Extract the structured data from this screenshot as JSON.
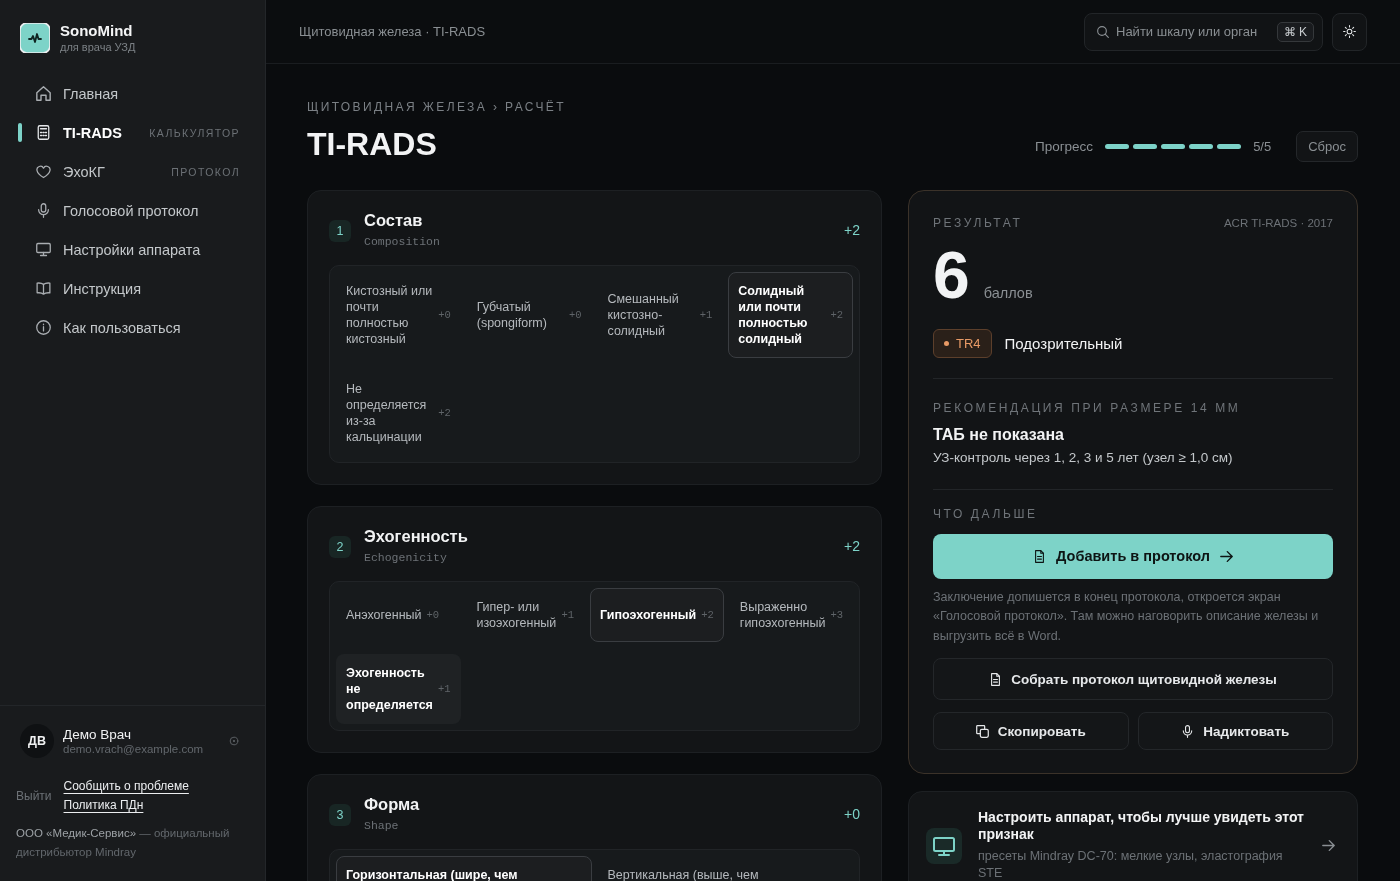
{
  "sidebar": {
    "brand": {
      "name": "SonoMind",
      "tagline": "для врача УЗД"
    },
    "nav": [
      {
        "label": "Главная",
        "selected": false
      },
      {
        "label": "TI-RADS",
        "tag": "КАЛЬКУЛЯТОР",
        "selected": true
      },
      {
        "label": "ЭхоКГ",
        "tag": "ПРОТОКОЛ",
        "selected": false
      },
      {
        "label": "Голосовой протокол",
        "selected": false
      },
      {
        "label": "Настройки аппарата",
        "selected": false
      },
      {
        "label": "Инструкция",
        "selected": false
      },
      {
        "label": "Как пользоваться",
        "selected": false
      }
    ],
    "user": {
      "initials": "ДВ",
      "name": "Демо Врач",
      "email": "demo.vrach@example.com"
    },
    "logout": "Выйти",
    "links": [
      "Сообщить о проблеме",
      "Политика ПДн"
    ],
    "footer": {
      "company": "ООО «Медик-Сервис»",
      "text": "— официальный дистрибьютор Mindray"
    }
  },
  "topbar": {
    "breadcrumb": "Щитовидная железа · TI-RADS",
    "search": {
      "placeholder": "Найти шкалу или орган",
      "shortcut": "⌘ K"
    }
  },
  "header": {
    "eyebrow": "ЩИТОВИДНАЯ ЖЕЛЕЗА › РАСЧЁТ",
    "title": "TI-RADS",
    "progress": {
      "label": "Прогресс",
      "steps": [
        {
          "done": true
        },
        {
          "done": true
        },
        {
          "done": true
        },
        {
          "done": true
        },
        {
          "done": true
        }
      ],
      "reading": "5/5"
    },
    "reset": "Сброс"
  },
  "criteria": [
    {
      "number": "1",
      "title": "Состав",
      "subtitle": "Composition",
      "score": "+2",
      "options": [
        {
          "label": "Кистозный или почти полностью кистозный",
          "points": "+0",
          "selected": false,
          "hovered": false
        },
        {
          "label": "Губчатый (spongiform)",
          "points": "+0",
          "selected": false,
          "hovered": false
        },
        {
          "label": "Смешанный кистозно-солидный",
          "points": "+1",
          "selected": false,
          "hovered": false
        },
        {
          "label": "Солидный или почти полностью солидный",
          "points": "+2",
          "selected": true,
          "hovered": false
        },
        {
          "label": "Не определяется из-за кальцинации",
          "points": "+2",
          "selected": false,
          "hovered": false
        }
      ]
    },
    {
      "number": "2",
      "title": "Эхогенность",
      "subtitle": "Echogenicity",
      "score": "+2",
      "options": [
        {
          "label": "Анэхогенный",
          "points": "+0",
          "selected": false,
          "hovered": false
        },
        {
          "label": "Гипер- или изоэхогенный",
          "points": "+1",
          "selected": false,
          "hovered": false
        },
        {
          "label": "Гипоэхогенный",
          "points": "+2",
          "selected": true,
          "hovered": false
        },
        {
          "label": "Выраженно гипоэхогенный",
          "points": "+3",
          "selected": false,
          "hovered": false
        },
        {
          "label": "Эхогенность не определяется",
          "points": "+1",
          "selected": false,
          "hovered": true
        }
      ]
    },
    {
      "number": "3",
      "title": "Форма",
      "subtitle": "Shape",
      "score": "+0",
      "options": [
        {
          "label": "Горизонтальная (шире, чем",
          "selected": true,
          "hovered": false
        },
        {
          "label": "Вертикальная (выше, чем",
          "selected": false,
          "hovered": false
        }
      ]
    }
  ],
  "result": {
    "eyebrow": "РЕЗУЛЬТАТ",
    "source": "ACR TI-RADS · 2017",
    "score": "6",
    "unit": "баллов",
    "category": {
      "code": "TR4",
      "label": "Подозрительный"
    },
    "recommendation": {
      "eyebrow": "РЕКОМЕНДАЦИЯ ПРИ РАЗМЕРЕ 14 ММ",
      "title": "ТАБ не показана",
      "text": "УЗ-контроль через 1, 2, 3 и 5 лет (узел ≥ 1,0 см)"
    },
    "next": {
      "eyebrow": "ЧТО ДАЛЬШЕ",
      "primary": "Добавить в протокол",
      "note": "Заключение допишется в конец протокола, откроется экран «Голосовой протокол». Там можно наговорить описание железы и выгрузить всё в Word.",
      "secondary": "Собрать протокол щитовидной железы",
      "actions": [
        "Скопировать",
        "Надиктовать"
      ]
    }
  },
  "tip": {
    "title": "Настроить аппарат, чтобы лучше увидеть этот признак",
    "text": "пресеты Mindray DC-70: мелкие узлы, эластография STE"
  }
}
